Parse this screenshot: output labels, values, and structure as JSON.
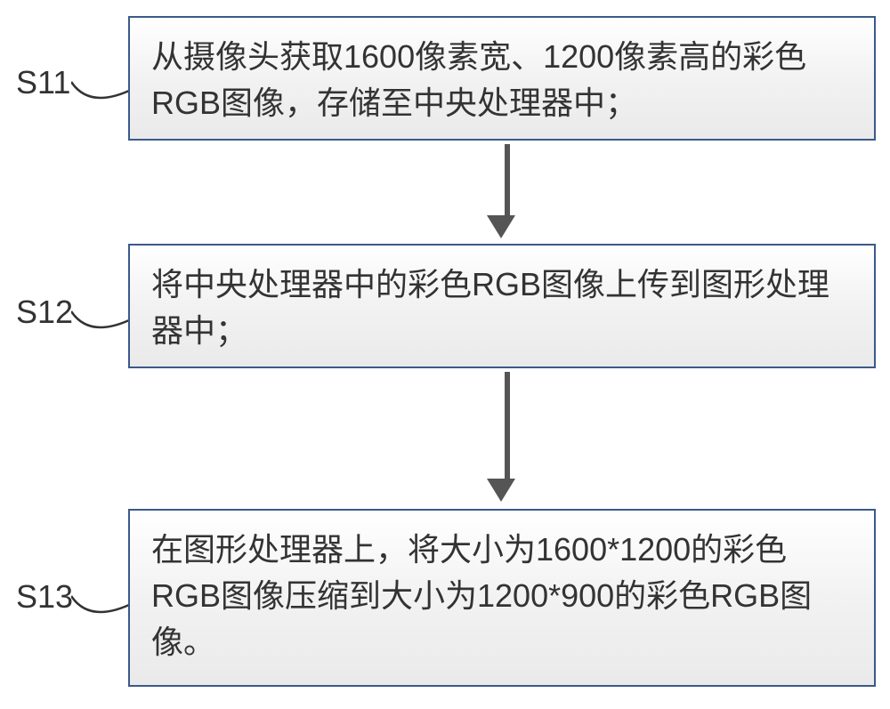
{
  "steps": [
    {
      "id": "S11",
      "text": "从摄像头获取1600像素宽、1200像素高的彩色RGB图像，存储至中央处理器中；"
    },
    {
      "id": "S12",
      "text": "将中央处理器中的彩色RGB图像上传到图形处理器中；"
    },
    {
      "id": "S13",
      "text": "在图形处理器上，将大小为1600*1200的彩色RGB图像压缩到大小为1200*900的彩色RGB图像。"
    }
  ]
}
